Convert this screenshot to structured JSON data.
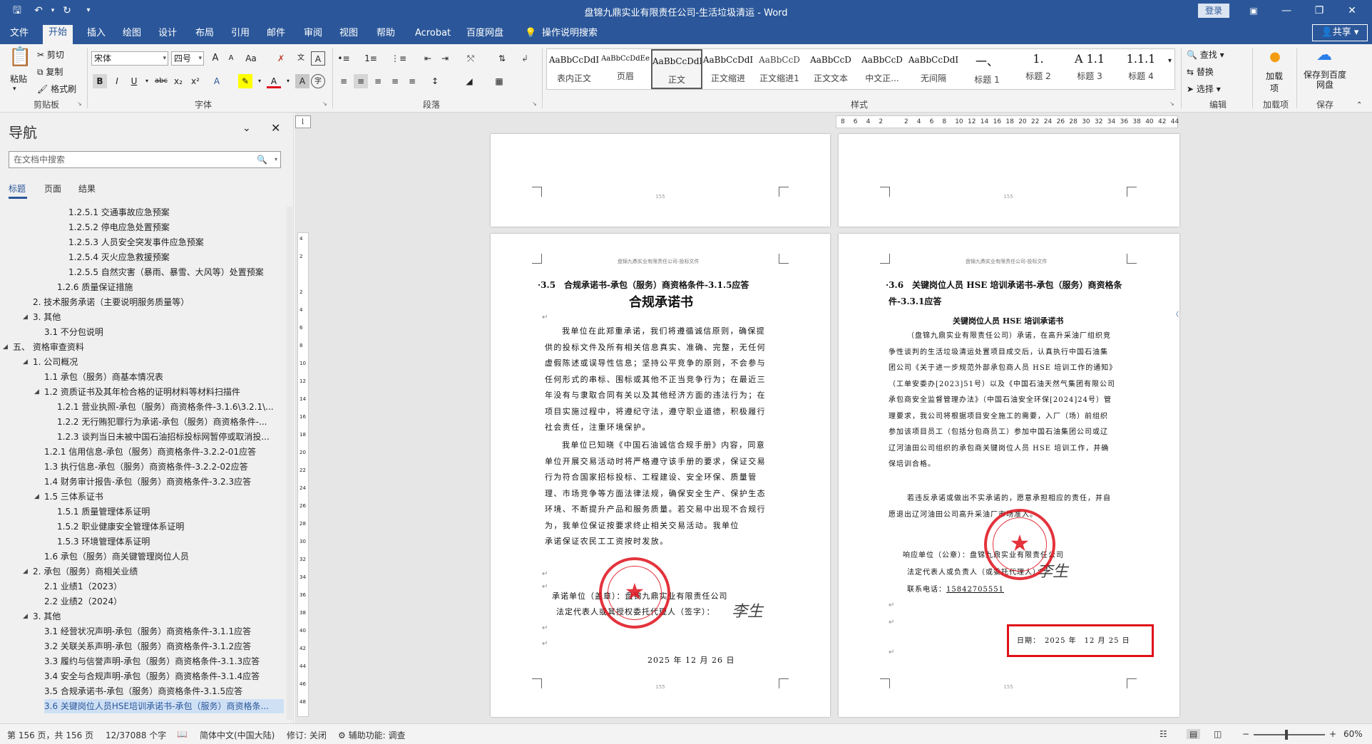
{
  "title_bar": {
    "document_title": "盘锦九鼎实业有限责任公司-生活垃圾清运",
    "separator": " - ",
    "app_name": "Word",
    "login_label": "登录"
  },
  "tabs": [
    "文件",
    "开始",
    "插入",
    "绘图",
    "设计",
    "布局",
    "引用",
    "邮件",
    "审阅",
    "视图",
    "帮助",
    "Acrobat",
    "百度网盘"
  ],
  "active_tab": "开始",
  "tell_me": "操作说明搜索",
  "share_label": "共享",
  "ribbon": {
    "clipboard": {
      "paste": "粘贴",
      "cut": "剪切",
      "copy": "复制",
      "format_painter": "格式刷",
      "label": "剪贴板"
    },
    "font": {
      "name": "宋体",
      "size": "四号",
      "label": "字体",
      "bold": "B",
      "italic": "I",
      "underline": "U",
      "strike": "abc",
      "sub": "x₂",
      "sup": "x²",
      "change_case": "Aa",
      "grow": "A",
      "shrink": "A"
    },
    "paragraph": {
      "label": "段落"
    },
    "styles": {
      "label": "样式",
      "preview": "AaBbCcDdI",
      "items": [
        "表内正文",
        "页眉",
        "正文",
        "正文缩进",
        "正文缩进1",
        "正文文本",
        "中文正...",
        "无间隔",
        "标题 1",
        "标题 2",
        "标题 3",
        "标题 4"
      ],
      "selected_index": 2
    },
    "editing": {
      "find": "查找",
      "replace": "替换",
      "select": "选择",
      "label": "编辑"
    },
    "addins": {
      "button": "加载项",
      "label": "加载项"
    },
    "save": {
      "button": "保存到百度网盘",
      "label": "保存"
    }
  },
  "nav": {
    "title": "导航",
    "search_placeholder": "在文档中搜索",
    "tabs": [
      "标题",
      "页面",
      "结果"
    ],
    "items": [
      {
        "text": "1.2.5.1 交通事故应急预案",
        "level": 5
      },
      {
        "text": "1.2.5.2 停电应急处置预案",
        "level": 5
      },
      {
        "text": "1.2.5.3 人员安全突发事件应急预案",
        "level": 5
      },
      {
        "text": "1.2.5.4 灭火应急救援预案",
        "level": 5
      },
      {
        "text": "1.2.5.5 自然灾害（暴雨、暴雪、大风等）处置预案",
        "level": 5
      },
      {
        "text": "1.2.6 质量保证措施",
        "level": 4
      },
      {
        "text": "2. 技术服务承诺（主要说明服务质量等）",
        "level": 2
      },
      {
        "text": "3. 其他",
        "level": 2,
        "expanded": true
      },
      {
        "text": "3.1 不分包说明",
        "level": 3
      },
      {
        "text": "五、 资格审查资料",
        "level": 1,
        "expanded": true
      },
      {
        "text": "1. 公司概况",
        "level": 2,
        "expanded": true
      },
      {
        "text": "1.1 承包（服务）商基本情况表",
        "level": 3
      },
      {
        "text": "1.2 资质证书及其年检合格的证明材料等材料扫描件",
        "level": 3,
        "expanded": true
      },
      {
        "text": "1.2.1 营业执照-承包（服务）商资格条件-3.1.6\\3.2.1\\...",
        "level": 4
      },
      {
        "text": "1.2.2 无行贿犯罪行为承诺-承包（服务）商资格条件-...",
        "level": 4
      },
      {
        "text": "1.2.3 谈判当日未被中国石油招标投标网暂停或取消投...",
        "level": 4
      },
      {
        "text": "1.2.1 信用信息-承包（服务）商资格条件-3.2.2-01应答",
        "level": 3
      },
      {
        "text": "1.3 执行信息-承包（服务）商资格条件-3.2.2-02应答",
        "level": 3
      },
      {
        "text": "1.4 财务审计报告-承包（服务）商资格条件-3.2.3应答",
        "level": 3
      },
      {
        "text": "1.5 三体系证书",
        "level": 3,
        "expanded": true
      },
      {
        "text": "1.5.1 质量管理体系证明",
        "level": 4
      },
      {
        "text": "1.5.2 职业健康安全管理体系证明",
        "level": 4
      },
      {
        "text": "1.5.3 环境管理体系证明",
        "level": 4
      },
      {
        "text": "1.6 承包（服务）商关键管理岗位人员",
        "level": 3
      },
      {
        "text": "2. 承包（服务）商相关业绩",
        "level": 2,
        "expanded": true
      },
      {
        "text": "2.1 业绩1（2023）",
        "level": 3
      },
      {
        "text": "2.2 业绩2（2024）",
        "level": 3
      },
      {
        "text": "3. 其他",
        "level": 2,
        "expanded": true
      },
      {
        "text": "3.1 经营状况声明-承包（服务）商资格条件-3.1.1应答",
        "level": 3
      },
      {
        "text": "3.2 关联关系声明-承包（服务）商资格条件-3.1.2应答",
        "level": 3
      },
      {
        "text": "3.3 履约与信誉声明-承包（服务）商资格条件-3.1.3应答",
        "level": 3
      },
      {
        "text": "3.4 安全与合规声明-承包（服务）商资格条件-3.1.4应答",
        "level": 3
      },
      {
        "text": "3.5 合规承诺书-承包（服务）商资格条件-3.1.5应答",
        "level": 3
      },
      {
        "text": "3.6 关键岗位人员HSE培训承诺书-承包（服务）商资格条...",
        "level": 3,
        "selected": true
      }
    ]
  },
  "ruler": {
    "h_ticks": [
      "8",
      "6",
      "4",
      "2",
      "",
      "2",
      "4",
      "6",
      "8",
      "10",
      "12",
      "14",
      "16",
      "18",
      "20",
      "22",
      "24",
      "26",
      "28",
      "30",
      "32",
      "34",
      "36",
      "38",
      "40",
      "42",
      "44"
    ],
    "v_ticks": [
      "4",
      "2",
      "",
      "2",
      "4",
      "6",
      "8",
      "10",
      "12",
      "14",
      "16",
      "18",
      "20",
      "22",
      "24",
      "26",
      "28",
      "30",
      "32",
      "34",
      "36",
      "38",
      "40",
      "42",
      "44",
      "46",
      "48"
    ]
  },
  "pages": {
    "top_left_num": "155",
    "top_right_num": "155",
    "left": {
      "header": "盘锦九鼎实业有限责任公司-投标文件",
      "heading": "·3.5　合规承诺书-承包（服务）商资格条件-3.1.5应答",
      "title": "合规承诺书",
      "para1": [
        "我单位在此郑重承诺，我们将遵循诚信原则，确保提",
        "供的投标文件及所有相关信息真实、准确、完整，无任何",
        "虚假陈述或误导性信息；坚持公平竞争的原则，不会参与",
        "任何形式的串标、围标或其他不正当竞争行为；在最近三",
        "年没有与隶取合同有关以及其他经济方面的违法行为；在",
        "项目实施过程中，将遵纪守法，遵守职业道德，积极履行",
        "社会责任，注重环境保护。"
      ],
      "para2": [
        "我单位已知晓《中国石油诚信合规手册》内容，同意",
        "单位开展交易活动时将严格遵守该手册的要求，保证交易",
        "行为符合国家招标投标、工程建设、安全环保、质量管",
        "理、市场竞争等方面法律法规，确保安全生产、保护生态",
        "环境、不断提升产品和服务质量。若交易中出现不合规行",
        "为，我单位保证按要求终止相关交易活动。我单位",
        "承诺保证农民工工资按时发放。"
      ],
      "sign1": "承诺单位（盖章）：盘锦九鼎实业有限责任公司",
      "sign2": "法定代表人或其授权委托代理人（签字）：",
      "date": "2025 年 12 月 26 日",
      "page_num": "155"
    },
    "right": {
      "header": "盘锦九鼎实业有限责任公司-投标文件",
      "heading_l1": "·3.6　关键岗位人员 HSE 培训承诺书-承包（服务）商资格条",
      "heading_l2": "件-3.3.1应答",
      "title": "关键岗位人员 HSE 培训承诺书",
      "para": [
        "（盘锦九鼎实业有限责任公司）承诺，在高升采油厂组织竞",
        "争性谈判的生活垃圾清运处置项目成交后，认真执行中国石油集",
        "团公司《关于进一步规范外部承包商人员 HSE 培训工作的通知》",
        "（工单安委办[2023]51号）以及《中国石油天然气集团有限公司",
        "承包商安全监督管理办法》（中国石油安全环保[2024]24号）管",
        "理要求，我公司将根据项目安全施工的需要，入厂（场）前组织",
        "参加该项目员工（包括分包商员工）参加中国石油集团公司或辽",
        "辽河油田公司组织的承包商关键岗位人员 HSE 培训工作，并确",
        "保培训合格。"
      ],
      "para_end": [
        "若违反承诺或做出不实承诺的，愿意承担相应的责任，并自",
        "愿退出辽河油田公司高升采油厂市场准入。"
      ],
      "sign1": "响应单位（公章）：盘锦九鼎实业有限责任公司",
      "sign2": "法定代表人或负责人（或委托代理人）：",
      "phone_label": "联系电话：",
      "phone": "15842705551",
      "date": "日期：　2025 年　12 月 25 日",
      "page_num": "155"
    }
  },
  "status": {
    "page": "第 156 页，共 156 页",
    "words": "12/37088 个字",
    "lang": "简体中文(中国大陆)",
    "track": "修订: 关闭",
    "access": "辅助功能: 调查",
    "zoom": "60%"
  },
  "colors": {
    "brand": "#2b579a",
    "seal": "#e0101b"
  }
}
